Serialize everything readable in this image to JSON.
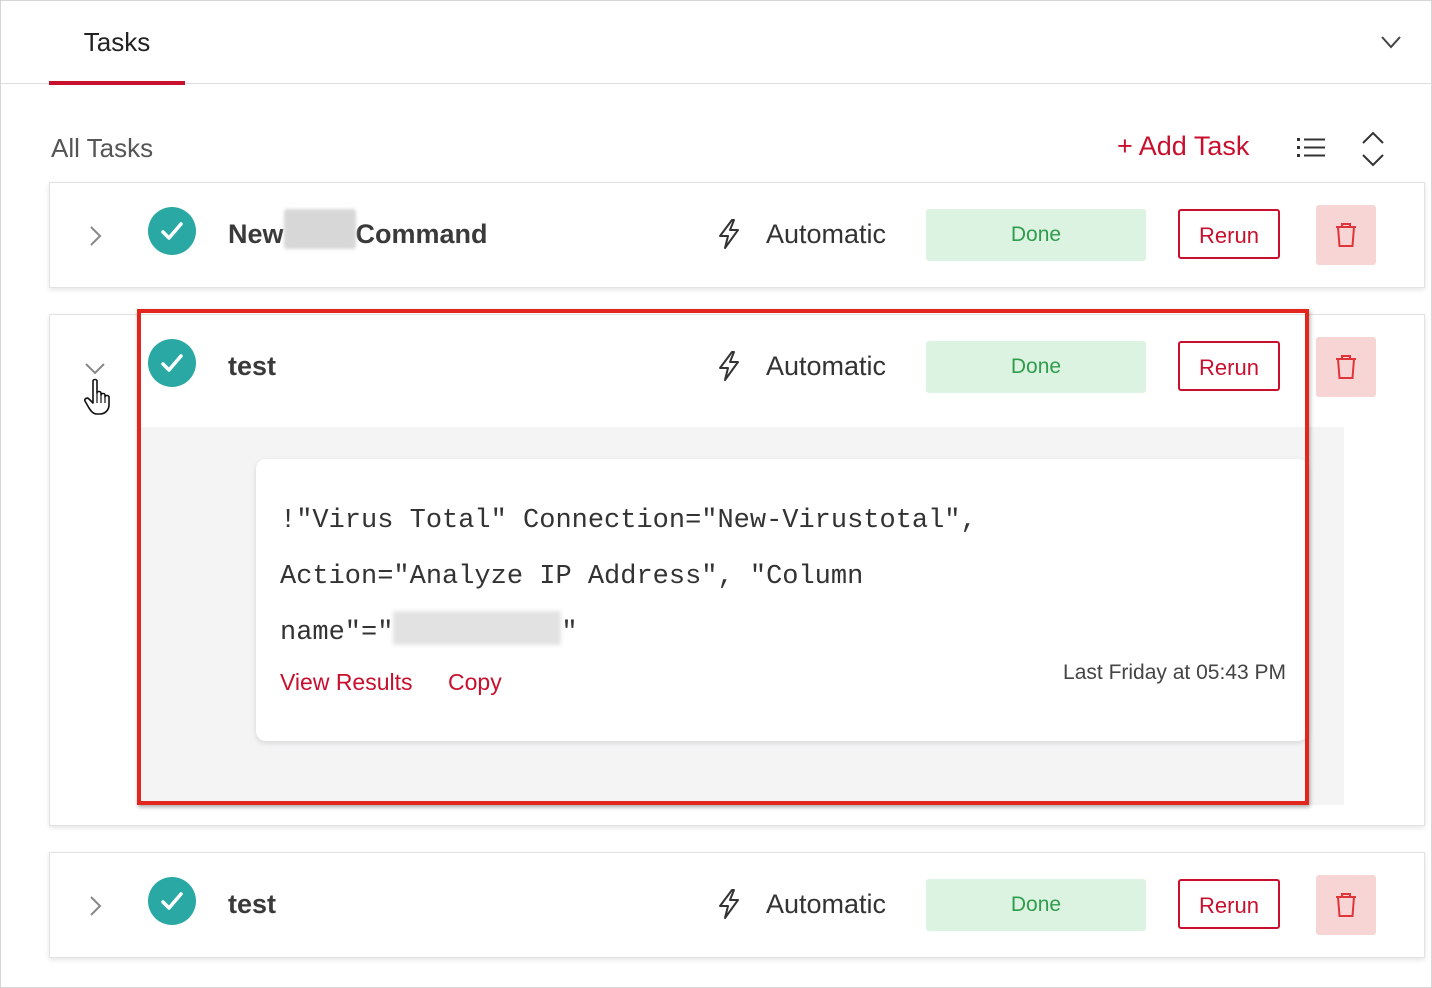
{
  "tabs": [
    {
      "label": "Tasks",
      "active": true
    }
  ],
  "header": {
    "section_title": "All Tasks",
    "add_task_label": "+ Add Task"
  },
  "tasks": [
    {
      "name_prefix": "New",
      "name_suffix": "Command",
      "mode": "Automatic",
      "status": "Done",
      "rerun_label": "Rerun",
      "expanded": false
    },
    {
      "name": "test",
      "mode": "Automatic",
      "status": "Done",
      "rerun_label": "Rerun",
      "expanded": true,
      "detail": {
        "command_line1": "!\"Virus Total\" Connection=\"New-Virustotal\",",
        "command_line2": "Action=\"Analyze IP Address\", \"Column",
        "command_line3_prefix": "name\"=\"",
        "command_line3_suffix": "\"",
        "view_results_label": "View Results",
        "copy_label": "Copy",
        "timestamp": "Last Friday at 05:43 PM"
      }
    },
    {
      "name": "test",
      "mode": "Automatic",
      "status": "Done",
      "rerun_label": "Rerun",
      "expanded": false
    }
  ],
  "colors": {
    "accent": "#c8102e",
    "success_bg": "#ddf3e1",
    "success_text": "#2e9d4c",
    "check": "#2aa8a4",
    "delete_bg": "#f8d5d5",
    "highlight": "#e3261d"
  },
  "icons": [
    "chevron-down-icon",
    "chevron-right-icon",
    "check-circle-icon",
    "lightning-icon",
    "trash-icon",
    "list-icon",
    "sort-icon",
    "hand-cursor-icon"
  ]
}
